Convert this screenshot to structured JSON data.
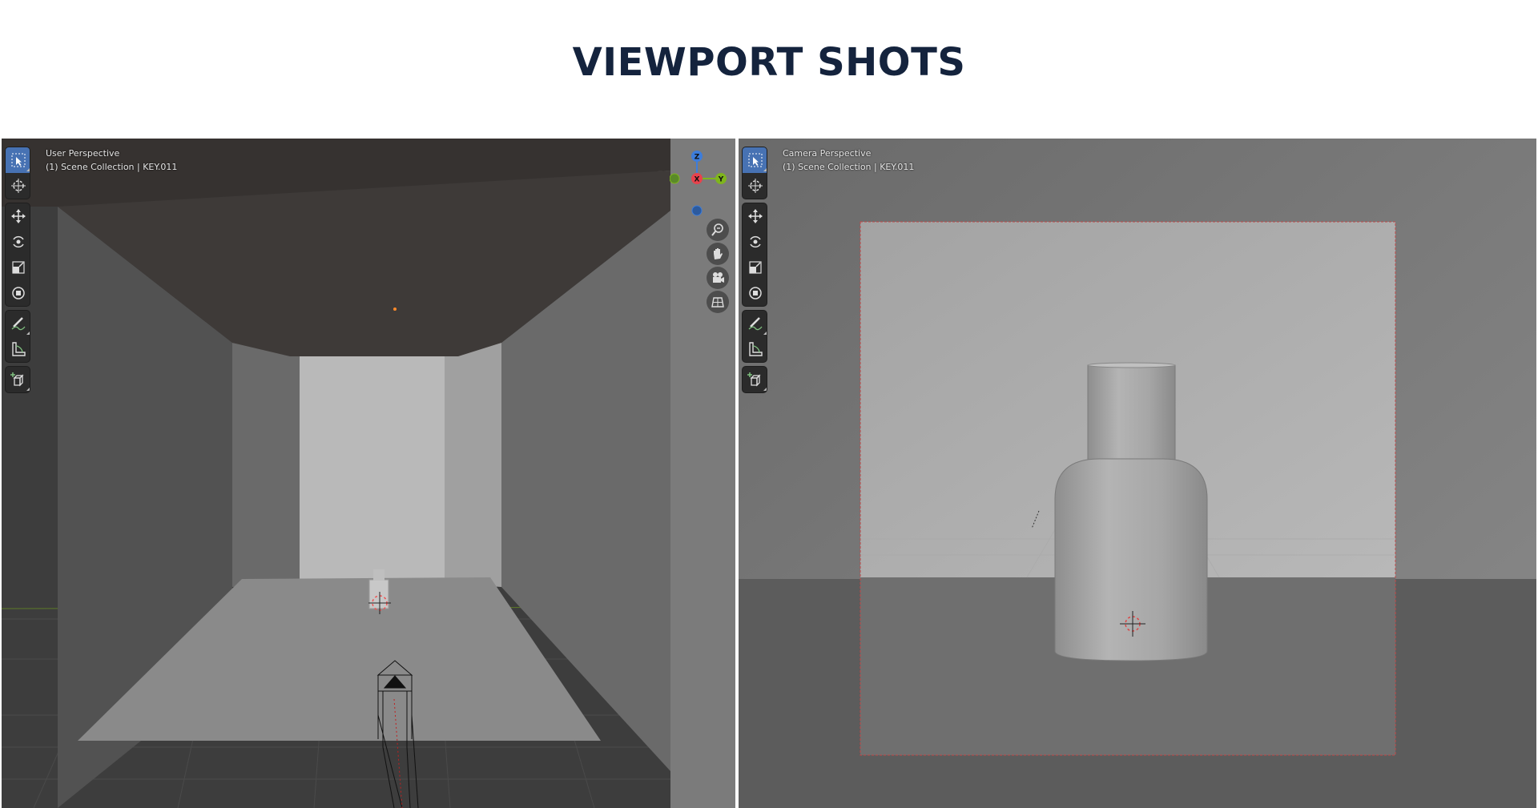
{
  "page": {
    "title": "VIEWPORT SHOTS"
  },
  "viewports": [
    {
      "view_name": "User Perspective",
      "collection": "(1) Scene Collection | KEY.011"
    },
    {
      "view_name": "Camera Perspective",
      "collection": "(1) Scene Collection | KEY.011"
    }
  ],
  "toolbar": {
    "tools": [
      "select-box",
      "cursor",
      "move",
      "rotate",
      "scale",
      "transform",
      "annotate",
      "measure",
      "add-cube"
    ],
    "active_tool": "select-box"
  },
  "gizmo": {
    "z_label": "Z",
    "y_label": "Y",
    "x_label": "X"
  },
  "nav_icons": [
    "zoom-icon",
    "pan-hand-icon",
    "camera-view-icon",
    "grid-view-icon"
  ],
  "colors": {
    "accent": "#4772b3",
    "x_axis": "#e8424c",
    "y_axis": "#7fb51d",
    "z_axis": "#3d7ddb",
    "title": "#14233d"
  }
}
